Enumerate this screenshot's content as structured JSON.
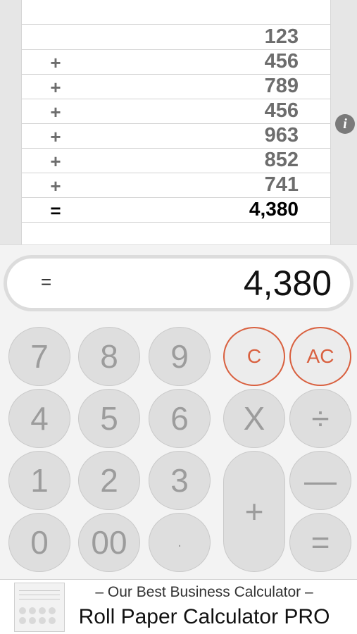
{
  "tape": {
    "rows": [
      {
        "op": "",
        "value": "123"
      },
      {
        "op": "+",
        "value": "456"
      },
      {
        "op": "+",
        "value": "789"
      },
      {
        "op": "+",
        "value": "456"
      },
      {
        "op": "+",
        "value": "963"
      },
      {
        "op": "+",
        "value": "852"
      },
      {
        "op": "+",
        "value": "741"
      },
      {
        "op": "=",
        "value": "4,380"
      }
    ]
  },
  "info_button": {
    "glyph": "i"
  },
  "display": {
    "op": "=",
    "value": "4,380"
  },
  "keys": {
    "seven": "7",
    "eight": "8",
    "nine": "9",
    "clear": "C",
    "all_clear": "AC",
    "four": "4",
    "five": "5",
    "six": "6",
    "multiply": "X",
    "divide": "÷",
    "one": "1",
    "two": "2",
    "three": "3",
    "plus": "+",
    "minus": "—",
    "zero": "0",
    "double_zero": "00",
    "decimal": ".",
    "equals": "="
  },
  "ad": {
    "tagline": "– Our Best Business Calculator –",
    "title": "Roll Paper Calculator PRO"
  },
  "colors": {
    "accent_red": "#d9603f",
    "key_fill": "#dedede",
    "paper": "#ffffff"
  }
}
